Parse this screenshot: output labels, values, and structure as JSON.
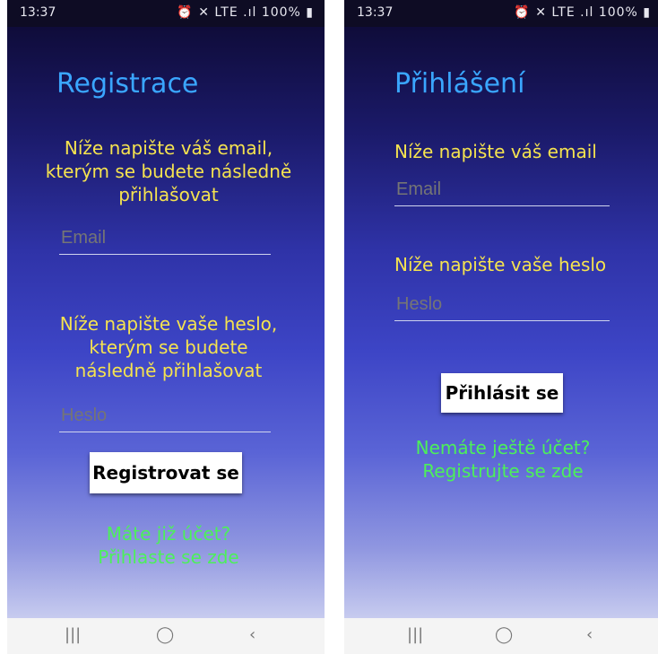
{
  "status_bar": {
    "time": "13:37",
    "battery": "100%",
    "icons": "⏰ ✕ LTE .ıl 100% ▮"
  },
  "nav_bar": {
    "recents": "|||",
    "home": "◯",
    "back": "‹"
  },
  "register": {
    "title": "Registrace",
    "email_prompt": "Níže napište váš email, kterým se budete následně přihlašovat",
    "email_placeholder": "Email",
    "password_prompt": "Níže napište vaše heslo, kterým se budete následně přihlašovat",
    "password_placeholder": "Heslo",
    "submit_label": "Registrovat se",
    "link_text": "Máte již účet? Přihlaste se zde"
  },
  "login": {
    "title": "Přihlášení",
    "email_prompt": "Níže napište váš email",
    "email_placeholder": "Email",
    "password_prompt": "Níže napište vaše heslo",
    "password_placeholder": "Heslo",
    "submit_label": "Přihlásit se",
    "link_text": "Nemáte ještě účet? Registrujte se zde"
  },
  "colors": {
    "title": "#3aa6ff",
    "prompt": "#f5e34f",
    "link": "#4cf05a",
    "button_bg": "#ffffff"
  }
}
